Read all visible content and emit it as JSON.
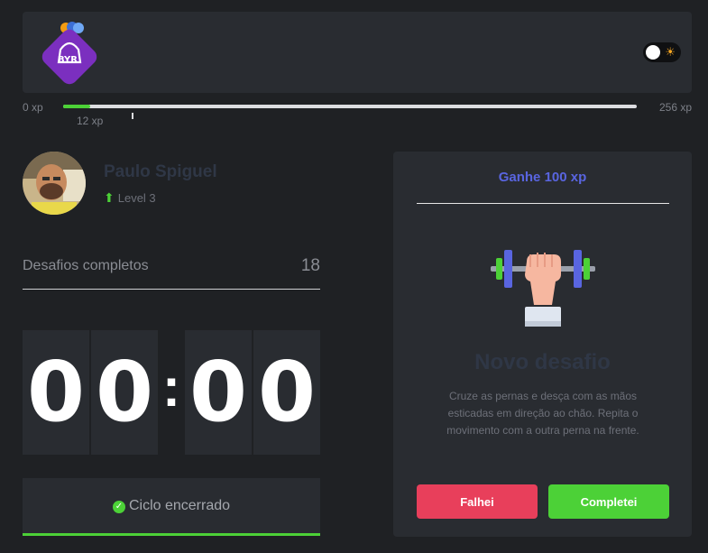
{
  "header": {
    "logo_text": "BYR",
    "logo_color": "#7b2fbf",
    "theme_toggle_icon": "sun-icon"
  },
  "xp": {
    "min_label": "0 xp",
    "max_label": "256 xp",
    "current_label": "12 xp",
    "progress_percent": 4.7,
    "fill_color": "#4cd137"
  },
  "profile": {
    "name": "Paulo Spiguel",
    "level": "Level 3",
    "level_icon": "level-up-arrow-icon"
  },
  "stats": {
    "completed_label": "Desafios completos",
    "completed_value": "18"
  },
  "timer": {
    "min_tens": "0",
    "min_ones": "0",
    "separator": ":",
    "sec_tens": "0",
    "sec_ones": "0"
  },
  "cycle": {
    "label": "Ciclo encerrado",
    "icon": "check-circle-icon"
  },
  "challenge": {
    "gain": "Ganhe 100 xp",
    "icon": "dumbbell-icon",
    "title": "Novo desafio",
    "description": "Cruze as pernas e desça com as mãos esticadas em direção ao chão. Repita o movimento com a outra perna na frente.",
    "fail_label": "Falhei",
    "done_label": "Completei",
    "fail_color": "#e83f5b",
    "done_color": "#4cd137",
    "accent_color": "#5965e0"
  }
}
